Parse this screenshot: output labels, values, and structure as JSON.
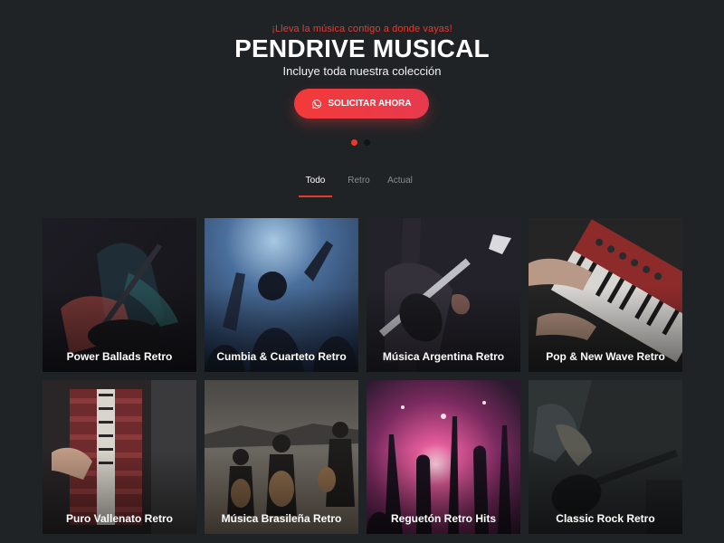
{
  "hero": {
    "tagline": "¡Lleva la música contigo a donde vayas!",
    "title": "PENDRIVE MUSICAL",
    "subtitle": "Incluye toda nuestra colección",
    "cta_label": "SOLICITAR AHORA",
    "cta_icon": "whatsapp-icon",
    "slides": 2,
    "active_slide": 1
  },
  "filters": {
    "tabs": [
      {
        "label": "Todo",
        "active": true
      },
      {
        "label": "Retro",
        "active": false
      },
      {
        "label": "Actual",
        "active": false
      }
    ]
  },
  "catalog": {
    "items": [
      {
        "label": "Power Ballads Retro"
      },
      {
        "label": "Cumbia & Cuarteto Retro"
      },
      {
        "label": "Música Argentina Retro"
      },
      {
        "label": "Pop & New Wave Retro"
      },
      {
        "label": "Puro Vallenato Retro"
      },
      {
        "label": "Música Brasileña Retro"
      },
      {
        "label": "Reguetón Retro Hits"
      },
      {
        "label": "Classic Rock Retro"
      }
    ]
  },
  "colors": {
    "background": "#202326",
    "accent": "#e8392f"
  }
}
